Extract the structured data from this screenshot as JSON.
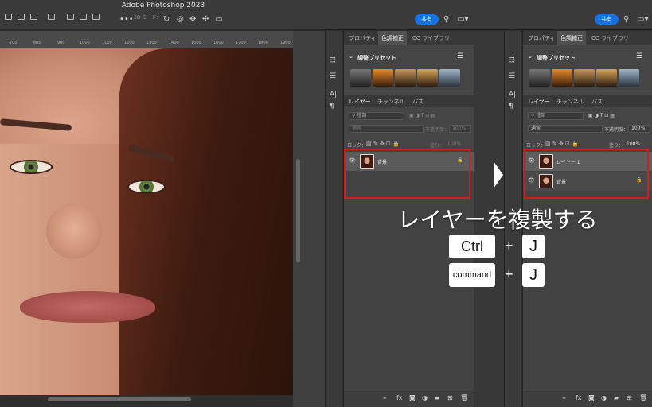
{
  "app_title": "Adobe Photoshop 2023",
  "toolbar": {
    "mode_label": "3D モード：",
    "share_label": "共有"
  },
  "ruler": {
    "ticks": [
      "700",
      "800",
      "900",
      "1000",
      "1100",
      "1200",
      "1300",
      "1400",
      "1500",
      "1600",
      "1700",
      "1800",
      "1900"
    ]
  },
  "panel_tabs": [
    "プロパティ",
    "色調補正",
    "CC ライブラリ"
  ],
  "adjustments": {
    "title": "調整プリセット"
  },
  "layer_tabs": [
    "レイヤー",
    "チャンネル",
    "パス"
  ],
  "layer_controls": {
    "kind_label": "種類",
    "blend_mode": "通常",
    "opacity_label": "不透明度：",
    "opacity_value": "100%",
    "lock_label": "ロック：",
    "fill_label": "塗り：",
    "fill_value": "100%"
  },
  "before": {
    "layers": [
      {
        "name": "背景"
      }
    ]
  },
  "after": {
    "layers": [
      {
        "name": "レイヤー 1"
      },
      {
        "name": "背景"
      }
    ]
  },
  "instruction": {
    "text": "レイヤーを複製する",
    "shortcut_win": {
      "key1": "Ctrl",
      "plus": "+",
      "key2": "J"
    },
    "shortcut_mac": {
      "key1": "command",
      "plus": "+",
      "key2": "J"
    }
  },
  "colors": {
    "highlight": "#d41c1c",
    "accent": "#1473e6",
    "panel": "#454545"
  },
  "icons": [
    "eye-icon",
    "lock-icon",
    "search-icon",
    "menu-icon",
    "fx-icon",
    "trash-icon",
    "new-layer-icon",
    "folder-icon",
    "mask-icon",
    "link-icon"
  ]
}
